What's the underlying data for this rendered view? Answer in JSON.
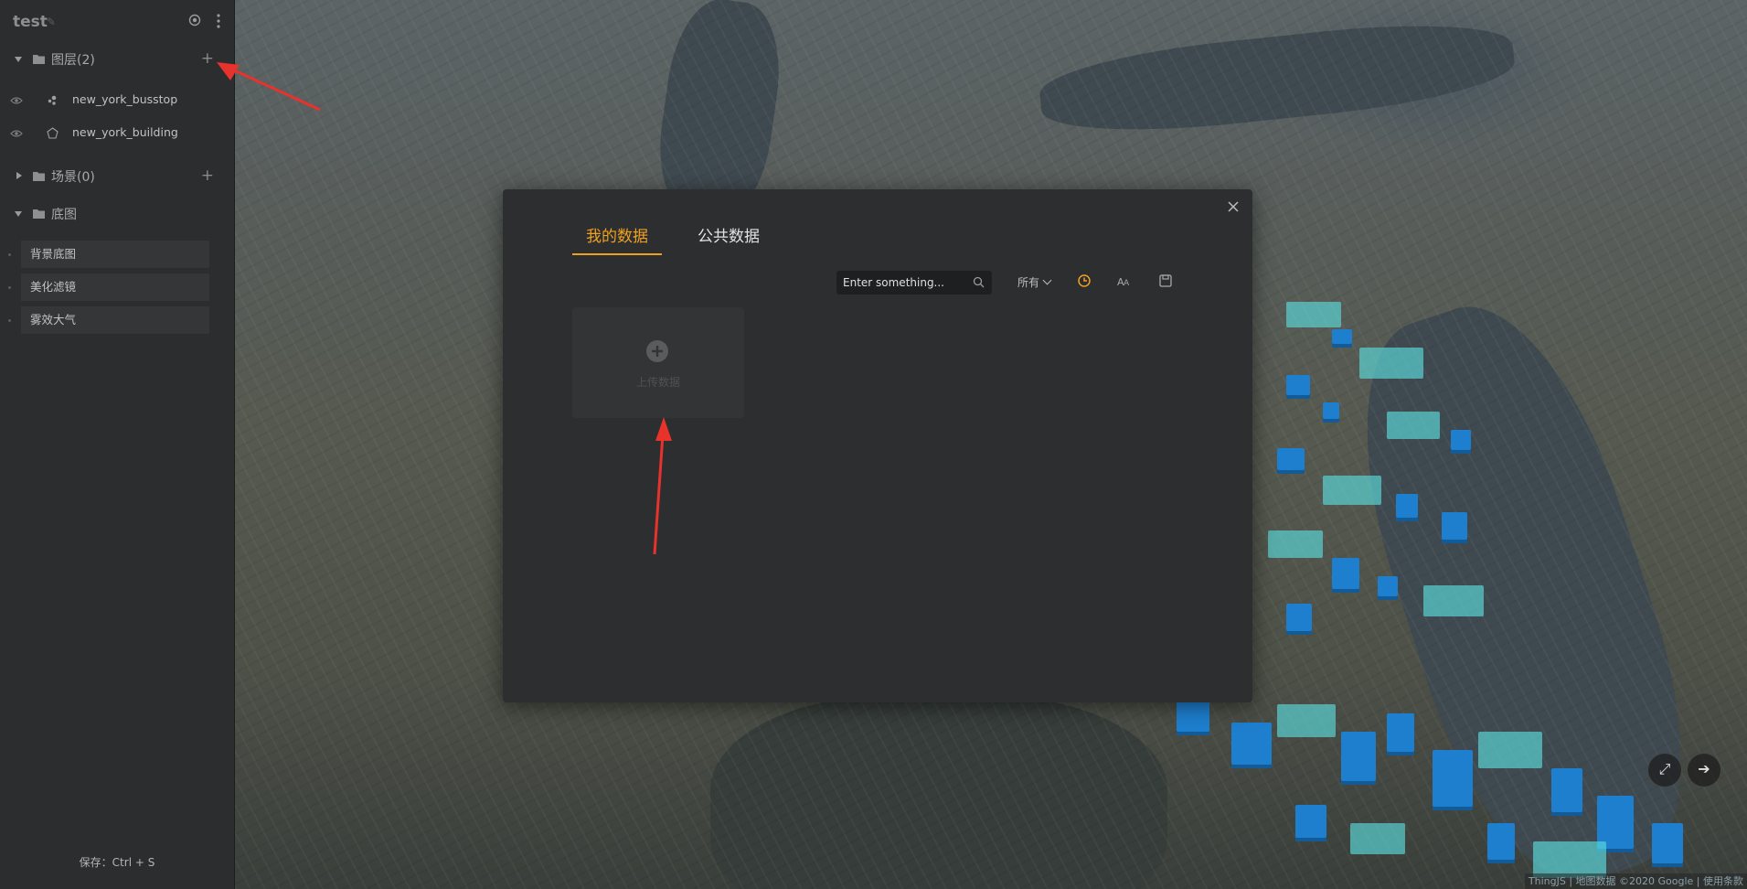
{
  "sidebar": {
    "project_title": "test",
    "sections": {
      "layers": {
        "label": "图层(2)",
        "expanded": true
      },
      "scenes": {
        "label": "场景(0)",
        "expanded": false
      },
      "basemap": {
        "label": "底图",
        "expanded": true
      }
    },
    "layers": [
      {
        "name": "new_york_busstop",
        "type_icon": "point-cluster-icon"
      },
      {
        "name": "new_york_building",
        "type_icon": "polygon-icon"
      }
    ],
    "basemap_items": [
      "背景底图",
      "美化滤镜",
      "雾效大气"
    ],
    "save_hint": "保存：Ctrl + S"
  },
  "modal": {
    "tabs": [
      {
        "label": "我的数据",
        "active": true
      },
      {
        "label": "公共数据",
        "active": false
      }
    ],
    "search": {
      "placeholder": "Enter something..."
    },
    "filter": {
      "selected": "所有"
    },
    "upload_label": "上传数据"
  },
  "map": {
    "attribution": "ThingJS | 地图数据 ©2020 Google | 使用条款"
  },
  "colors": {
    "accent": "#f0a020",
    "annotation": "#e8322c",
    "building_blue": "#1e7fcf",
    "building_cyan": "#5adcdc"
  }
}
